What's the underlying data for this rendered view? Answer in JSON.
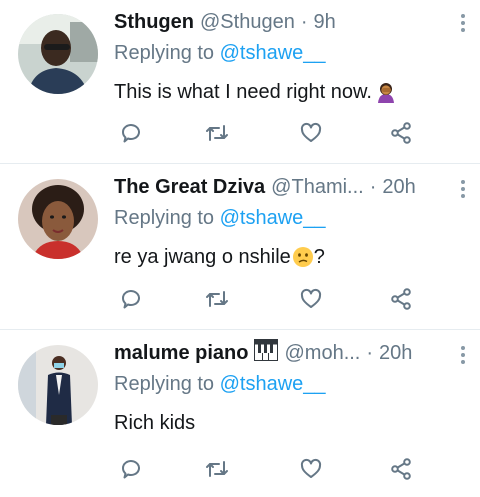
{
  "colors": {
    "accent": "#1da1f2",
    "secondary_text": "#657786",
    "icon": "#657786"
  },
  "tweets": [
    {
      "name": "Sthugen",
      "handle": "@Sthugen",
      "separator": "·",
      "time": "9h",
      "replying_prefix": "Replying to",
      "replying_to": "@tshawe__",
      "text": "This is what I need right now.",
      "text_emoji": "woman-facepalming-emoji"
    },
    {
      "name": "The Great Dziva",
      "handle": "@Thami...",
      "separator": "·",
      "time": "20h",
      "replying_prefix": "Replying to",
      "replying_to": "@tshawe__",
      "text": "re ya jwang o nshile",
      "text_emoji": "confused-face-emoji",
      "text_suffix": "?"
    },
    {
      "name": "malume piano",
      "name_emoji": "piano-keys-emoji",
      "handle": "@moh...",
      "separator": "·",
      "time": "20h",
      "replying_prefix": "Replying to",
      "replying_to": "@tshawe__",
      "text": "Rich kids"
    }
  ],
  "icons": [
    "reply-icon",
    "retweet-icon",
    "like-icon",
    "share-icon",
    "more-icon"
  ]
}
